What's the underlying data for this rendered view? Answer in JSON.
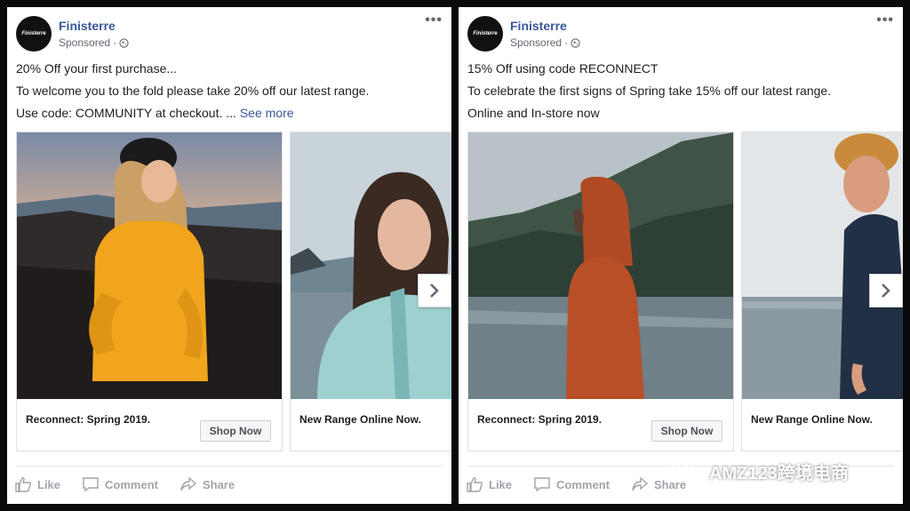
{
  "posts": [
    {
      "page_name": "Finisterre",
      "avatar_text": "Finisterre",
      "sponsored": "Sponsored ·",
      "lines": [
        "20% Off your first purchase...",
        "To welcome you to the fold please take 20% off our latest range.",
        "Use code: COMMUNITY at checkout. ..."
      ],
      "see_more": "See more",
      "cards": [
        {
          "headline": "Reconnect: Spring 2019.",
          "cta": "Shop Now"
        },
        {
          "headline": "New Range Online Now."
        }
      ]
    },
    {
      "page_name": "Finisterre",
      "avatar_text": "Finisterre",
      "sponsored": "Sponsored ·",
      "lines": [
        "15% Off using code RECONNECT",
        "To celebrate the first signs of Spring take 15% off our latest range.",
        "Online and In-store now"
      ],
      "cards": [
        {
          "headline": "Reconnect: Spring 2019.",
          "cta": "Shop Now"
        },
        {
          "headline": "New Range Online Now."
        }
      ]
    }
  ],
  "actions": {
    "like": "Like",
    "comment": "Comment",
    "share": "Share"
  },
  "watermark": "AMZ123跨境电商",
  "colors": {
    "link": "#385898",
    "muted": "#606770",
    "action": "#a0a4aa",
    "background": "#0a0a0a"
  }
}
